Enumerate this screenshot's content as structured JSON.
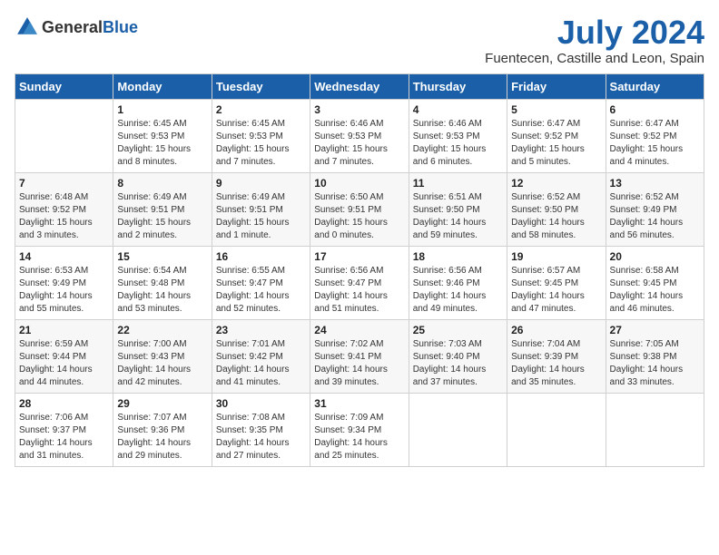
{
  "header": {
    "logo_general": "General",
    "logo_blue": "Blue",
    "month_title": "July 2024",
    "location": "Fuentecen, Castille and Leon, Spain"
  },
  "weekdays": [
    "Sunday",
    "Monday",
    "Tuesday",
    "Wednesday",
    "Thursday",
    "Friday",
    "Saturday"
  ],
  "weeks": [
    [
      {
        "day": "",
        "sunrise": "",
        "sunset": "",
        "daylight": ""
      },
      {
        "day": "1",
        "sunrise": "Sunrise: 6:45 AM",
        "sunset": "Sunset: 9:53 PM",
        "daylight": "Daylight: 15 hours and 8 minutes."
      },
      {
        "day": "2",
        "sunrise": "Sunrise: 6:45 AM",
        "sunset": "Sunset: 9:53 PM",
        "daylight": "Daylight: 15 hours and 7 minutes."
      },
      {
        "day": "3",
        "sunrise": "Sunrise: 6:46 AM",
        "sunset": "Sunset: 9:53 PM",
        "daylight": "Daylight: 15 hours and 7 minutes."
      },
      {
        "day": "4",
        "sunrise": "Sunrise: 6:46 AM",
        "sunset": "Sunset: 9:53 PM",
        "daylight": "Daylight: 15 hours and 6 minutes."
      },
      {
        "day": "5",
        "sunrise": "Sunrise: 6:47 AM",
        "sunset": "Sunset: 9:52 PM",
        "daylight": "Daylight: 15 hours and 5 minutes."
      },
      {
        "day": "6",
        "sunrise": "Sunrise: 6:47 AM",
        "sunset": "Sunset: 9:52 PM",
        "daylight": "Daylight: 15 hours and 4 minutes."
      }
    ],
    [
      {
        "day": "7",
        "sunrise": "Sunrise: 6:48 AM",
        "sunset": "Sunset: 9:52 PM",
        "daylight": "Daylight: 15 hours and 3 minutes."
      },
      {
        "day": "8",
        "sunrise": "Sunrise: 6:49 AM",
        "sunset": "Sunset: 9:51 PM",
        "daylight": "Daylight: 15 hours and 2 minutes."
      },
      {
        "day": "9",
        "sunrise": "Sunrise: 6:49 AM",
        "sunset": "Sunset: 9:51 PM",
        "daylight": "Daylight: 15 hours and 1 minute."
      },
      {
        "day": "10",
        "sunrise": "Sunrise: 6:50 AM",
        "sunset": "Sunset: 9:51 PM",
        "daylight": "Daylight: 15 hours and 0 minutes."
      },
      {
        "day": "11",
        "sunrise": "Sunrise: 6:51 AM",
        "sunset": "Sunset: 9:50 PM",
        "daylight": "Daylight: 14 hours and 59 minutes."
      },
      {
        "day": "12",
        "sunrise": "Sunrise: 6:52 AM",
        "sunset": "Sunset: 9:50 PM",
        "daylight": "Daylight: 14 hours and 58 minutes."
      },
      {
        "day": "13",
        "sunrise": "Sunrise: 6:52 AM",
        "sunset": "Sunset: 9:49 PM",
        "daylight": "Daylight: 14 hours and 56 minutes."
      }
    ],
    [
      {
        "day": "14",
        "sunrise": "Sunrise: 6:53 AM",
        "sunset": "Sunset: 9:49 PM",
        "daylight": "Daylight: 14 hours and 55 minutes."
      },
      {
        "day": "15",
        "sunrise": "Sunrise: 6:54 AM",
        "sunset": "Sunset: 9:48 PM",
        "daylight": "Daylight: 14 hours and 53 minutes."
      },
      {
        "day": "16",
        "sunrise": "Sunrise: 6:55 AM",
        "sunset": "Sunset: 9:47 PM",
        "daylight": "Daylight: 14 hours and 52 minutes."
      },
      {
        "day": "17",
        "sunrise": "Sunrise: 6:56 AM",
        "sunset": "Sunset: 9:47 PM",
        "daylight": "Daylight: 14 hours and 51 minutes."
      },
      {
        "day": "18",
        "sunrise": "Sunrise: 6:56 AM",
        "sunset": "Sunset: 9:46 PM",
        "daylight": "Daylight: 14 hours and 49 minutes."
      },
      {
        "day": "19",
        "sunrise": "Sunrise: 6:57 AM",
        "sunset": "Sunset: 9:45 PM",
        "daylight": "Daylight: 14 hours and 47 minutes."
      },
      {
        "day": "20",
        "sunrise": "Sunrise: 6:58 AM",
        "sunset": "Sunset: 9:45 PM",
        "daylight": "Daylight: 14 hours and 46 minutes."
      }
    ],
    [
      {
        "day": "21",
        "sunrise": "Sunrise: 6:59 AM",
        "sunset": "Sunset: 9:44 PM",
        "daylight": "Daylight: 14 hours and 44 minutes."
      },
      {
        "day": "22",
        "sunrise": "Sunrise: 7:00 AM",
        "sunset": "Sunset: 9:43 PM",
        "daylight": "Daylight: 14 hours and 42 minutes."
      },
      {
        "day": "23",
        "sunrise": "Sunrise: 7:01 AM",
        "sunset": "Sunset: 9:42 PM",
        "daylight": "Daylight: 14 hours and 41 minutes."
      },
      {
        "day": "24",
        "sunrise": "Sunrise: 7:02 AM",
        "sunset": "Sunset: 9:41 PM",
        "daylight": "Daylight: 14 hours and 39 minutes."
      },
      {
        "day": "25",
        "sunrise": "Sunrise: 7:03 AM",
        "sunset": "Sunset: 9:40 PM",
        "daylight": "Daylight: 14 hours and 37 minutes."
      },
      {
        "day": "26",
        "sunrise": "Sunrise: 7:04 AM",
        "sunset": "Sunset: 9:39 PM",
        "daylight": "Daylight: 14 hours and 35 minutes."
      },
      {
        "day": "27",
        "sunrise": "Sunrise: 7:05 AM",
        "sunset": "Sunset: 9:38 PM",
        "daylight": "Daylight: 14 hours and 33 minutes."
      }
    ],
    [
      {
        "day": "28",
        "sunrise": "Sunrise: 7:06 AM",
        "sunset": "Sunset: 9:37 PM",
        "daylight": "Daylight: 14 hours and 31 minutes."
      },
      {
        "day": "29",
        "sunrise": "Sunrise: 7:07 AM",
        "sunset": "Sunset: 9:36 PM",
        "daylight": "Daylight: 14 hours and 29 minutes."
      },
      {
        "day": "30",
        "sunrise": "Sunrise: 7:08 AM",
        "sunset": "Sunset: 9:35 PM",
        "daylight": "Daylight: 14 hours and 27 minutes."
      },
      {
        "day": "31",
        "sunrise": "Sunrise: 7:09 AM",
        "sunset": "Sunset: 9:34 PM",
        "daylight": "Daylight: 14 hours and 25 minutes."
      },
      {
        "day": "",
        "sunrise": "",
        "sunset": "",
        "daylight": ""
      },
      {
        "day": "",
        "sunrise": "",
        "sunset": "",
        "daylight": ""
      },
      {
        "day": "",
        "sunrise": "",
        "sunset": "",
        "daylight": ""
      }
    ]
  ]
}
